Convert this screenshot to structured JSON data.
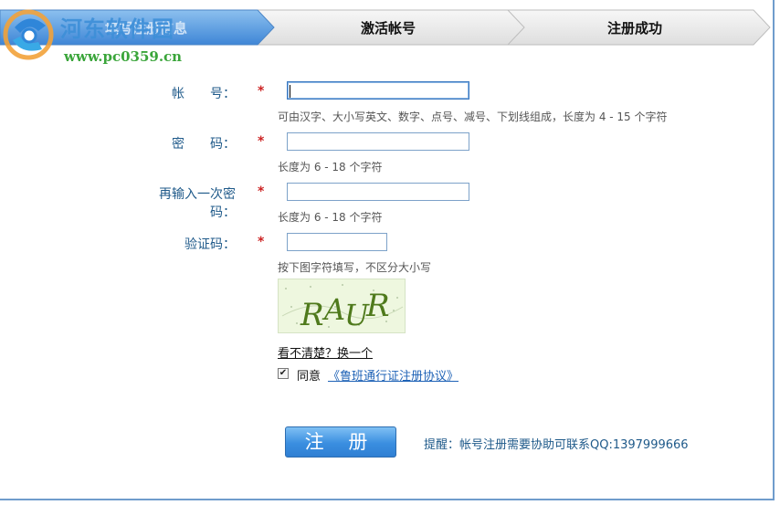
{
  "steps": {
    "items": [
      {
        "label": "填写注册信息"
      },
      {
        "label": "激活帐号"
      },
      {
        "label": "注册成功"
      }
    ],
    "active_color": "#4a8fd8",
    "inactive_color": "#e6e6e6"
  },
  "watermark": {
    "site_name": "河东软件园",
    "url": "www.pc0359.cn",
    "icon": "pc0359-logo"
  },
  "form": {
    "account": {
      "label": "帐　　号：",
      "value": "",
      "hint": "可由汉字、大小写英文、数字、点号、减号、下划线组成，长度为 4 - 15 个字符"
    },
    "password": {
      "label": "密　　码：",
      "value": "",
      "hint": "长度为 6 - 18 个字符"
    },
    "confirm": {
      "label": "再输入一次密码：",
      "value": "",
      "hint": "长度为 6 - 18 个字符"
    },
    "captcha": {
      "label": "验证码：",
      "value": "",
      "hint": "按下图字符填写，不区分大小写",
      "image_text": "RAUR"
    },
    "required_mark": "*",
    "refresh_link": "看不清楚？换一个",
    "agree": {
      "checked": true,
      "text": "同意",
      "link": "《鲁班通行证注册协议》"
    },
    "submit_label": "注 册",
    "notice": "提醒：帐号注册需要协助可联系QQ:1397999666"
  },
  "colors": {
    "label": "#1f5a8a",
    "required": "#cc2222",
    "link": "#1e62b6",
    "border": "#6f9ccc"
  }
}
